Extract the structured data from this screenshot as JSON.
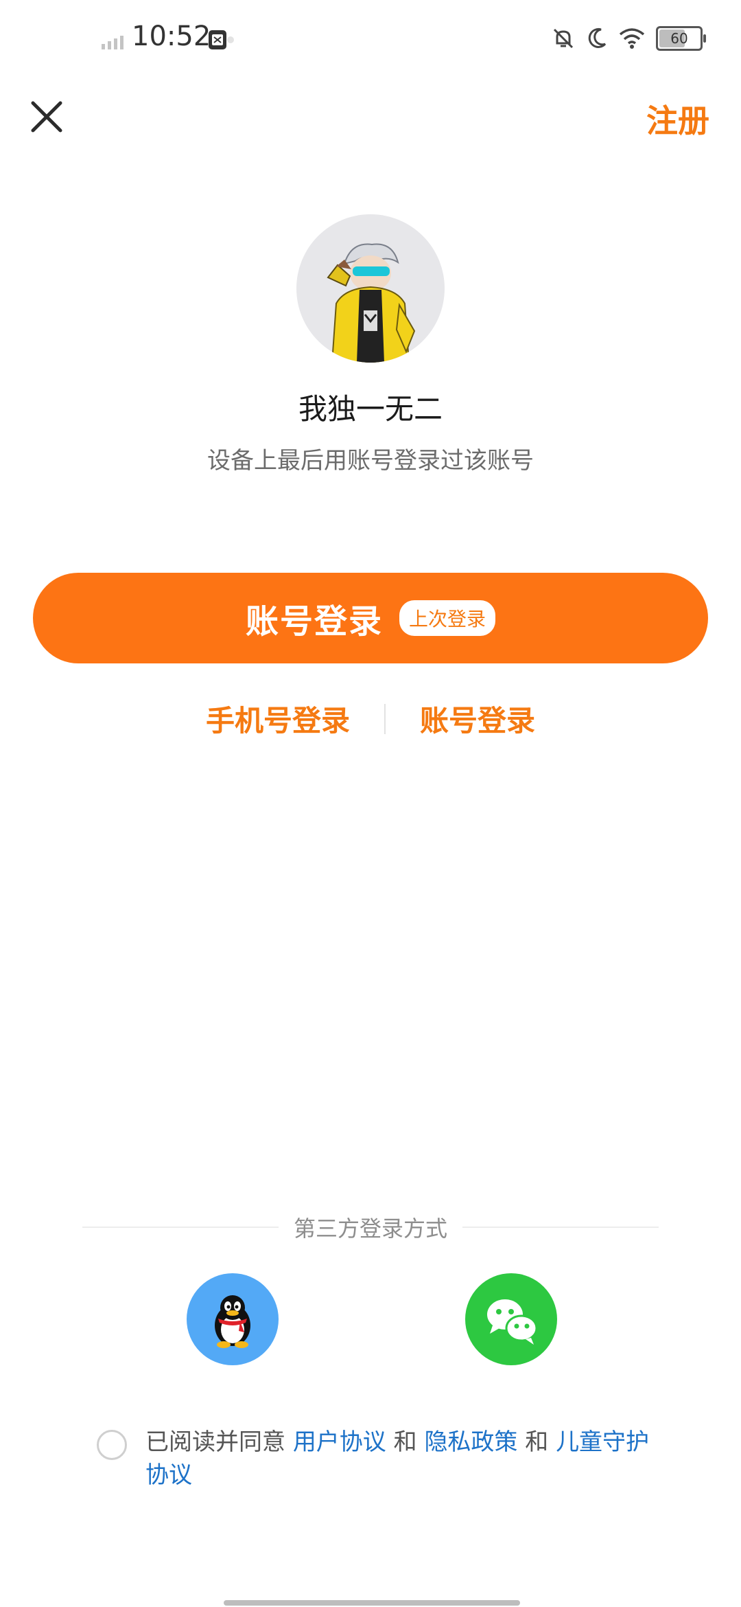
{
  "status_bar": {
    "time": "10:52",
    "battery": "60",
    "battery_level_percent": 60
  },
  "header": {
    "register_label": "注册"
  },
  "account": {
    "username": "我独一无二",
    "hint": "设备上最后用账号登录过该账号"
  },
  "primary_login": {
    "label": "账号登录",
    "badge": "上次登录"
  },
  "alt_login": {
    "phone_label": "手机号登录",
    "account_label": "账号登录"
  },
  "third_party": {
    "title": "第三方登录方式"
  },
  "agreement": {
    "prefix": "已阅读并同意 ",
    "user_agreement": "用户协议",
    "and1": " 和 ",
    "privacy_policy": "隐私政策",
    "and2": " 和 ",
    "child_protection": "儿童守护协议"
  },
  "colors": {
    "accent": "#fd7414",
    "link": "#1d72c8",
    "qq": "#53a9f6",
    "wechat": "#2dc841"
  }
}
